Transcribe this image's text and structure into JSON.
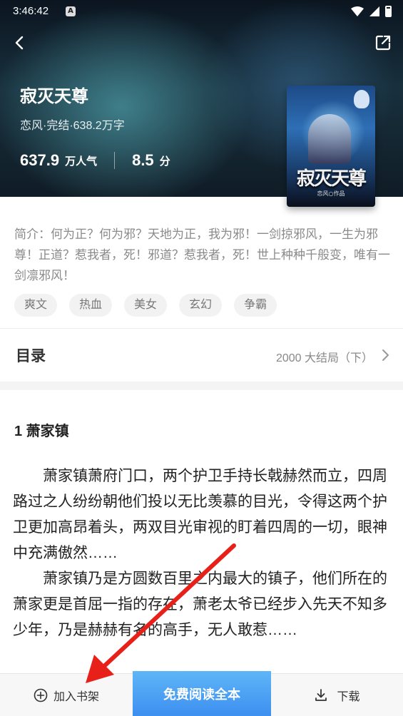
{
  "status": {
    "time": "3:46:42",
    "notif_letter": "A"
  },
  "book": {
    "title": "寂灭天尊",
    "meta": "恋风·完结·638.2万字",
    "popularity_value": "637.9",
    "popularity_unit": "万人气",
    "score_value": "8.5",
    "score_unit": "分",
    "cover_title": "寂灭天尊",
    "cover_author": "恋风○作品"
  },
  "intro": "简介：何为正？何为邪？天地为正，我为邪！一剑掠邪风，一生为邪尊！正道？惹我者，死！邪道？惹我者，死！世上种种千般变，唯有一剑凛邪风！",
  "tags": [
    "爽文",
    "热血",
    "美女",
    "玄幻",
    "争霸"
  ],
  "toc": {
    "label": "目录",
    "latest": "2000 大结局（下）"
  },
  "chapter": {
    "title": "1 萧家镇",
    "para1": "萧家镇萧府门口，两个护卫手持长戟赫然而立，四周路过之人纷纷朝他们投以无比羡慕的目光，令得这两个护卫更加高昂着头，两双目光审视的盯着四周的一切，眼神中充满傲然……",
    "para2": "萧家镇乃是方圆数百里之内最大的镇子，他们所在的萧家更是首屈一指的存在，萧老太爷已经步入先天不知多少年，乃是赫赫有名的高手，无人敢惹……"
  },
  "bottom": {
    "shelf_label": "加入书架",
    "read_label": "免费阅读全本",
    "download_label": "下载"
  },
  "colors": {
    "accent": "#3d8ef0",
    "annotation": "#e8201a"
  }
}
